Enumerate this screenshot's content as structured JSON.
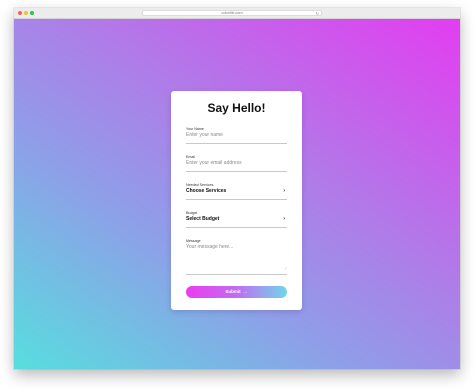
{
  "browser": {
    "url": "colorlib.com"
  },
  "form": {
    "title": "Say Hello!",
    "name": {
      "label": "Your Name",
      "placeholder": "Enter your name"
    },
    "email": {
      "label": "Email",
      "placeholder": "Enter your email address"
    },
    "services": {
      "label": "Needed Services",
      "value": "Choose Services",
      "icon": "chevron-right-icon"
    },
    "budget": {
      "label": "Budget",
      "value": "Select Budget",
      "icon": "chevron-right-icon"
    },
    "message": {
      "label": "Message",
      "placeholder": "Your message here..."
    },
    "submit": {
      "label": "Submit",
      "arrow": "→"
    }
  },
  "colors": {
    "gradient_start": "#57dede",
    "gradient_end": "#e33df0",
    "button_start": "#ea3df0",
    "button_end": "#6fd7ea"
  }
}
